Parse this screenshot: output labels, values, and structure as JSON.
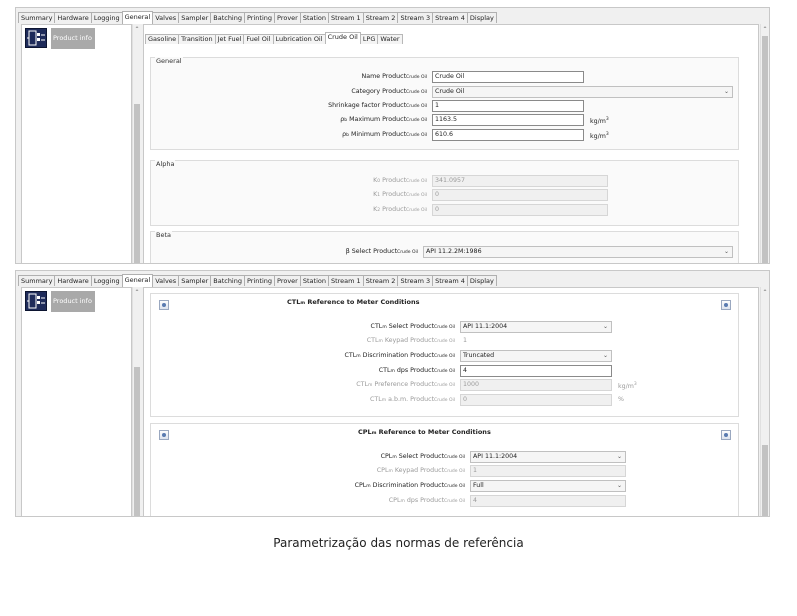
{
  "main_tabs": [
    "Summary",
    "Hardware",
    "Logging",
    "General",
    "Valves",
    "Sampler",
    "Batching",
    "Printing",
    "Prover",
    "Station",
    "Stream 1",
    "Stream 2",
    "Stream 3",
    "Stream 4",
    "Display"
  ],
  "active_main_tab": "General",
  "left_panel": {
    "icon": "flow-meter-icon",
    "item_label": "Product info"
  },
  "product_tabs": [
    "Gasoline",
    "Transition",
    "Jet Fuel",
    "Fuel Oil",
    "Lubrication Oil",
    "Crude Oil",
    "LPG",
    "Water"
  ],
  "active_product_tab": "Crude Oil",
  "product_subscript": "Crude Oil",
  "general": {
    "title": "General",
    "name_label": "Name Product",
    "name_value": "Crude Oil",
    "category_label": "Category Product",
    "category_value": "Crude Oil",
    "shrinkage_label": "Shrinkage factor Product",
    "shrinkage_value": "1",
    "rho_max_symbol": "ρ",
    "rho_sub": "b",
    "rho_max_label": " Maximum Product",
    "rho_max_value": "1163.5",
    "rho_min_label": " Minimum Product",
    "rho_min_value": "610.6",
    "density_unit": "kg/m",
    "density_unit_exp": "3"
  },
  "alpha": {
    "title": "Alpha",
    "k0_label": "K",
    "k0_sub": "0",
    "k0_value": "341.0957",
    "k1_label": "K",
    "k1_sub": "1",
    "k1_value": "0",
    "k2_label": "K",
    "k2_sub": "2",
    "k2_value": "0",
    "product_label": " Product"
  },
  "beta": {
    "title": "Beta",
    "select_label": "β Select Product",
    "select_value": "API 11.2.2M:1986"
  },
  "ctl": {
    "prefix": "CTL",
    "prefix_sub": "m",
    "title_rest": " Reference to Meter Conditions",
    "select_label": " Select Product",
    "select_value": "API 11.1:2004",
    "keypad_label": " Keypad Product",
    "keypad_value": "1",
    "discrimination_label": " Discrimination Product",
    "discrimination_value": "Truncated",
    "dps_label": " dps Product",
    "dps_value": "4",
    "preference_label": " Preference Product",
    "preference_value": "1000",
    "preference_unit": "kg/m",
    "preference_unit_exp": "3",
    "abm_label": " a.b.m. Product",
    "abm_value": "0",
    "abm_unit": "%"
  },
  "cpl": {
    "prefix": "CPL",
    "prefix_sub": "m",
    "title_rest": " Reference to Meter Conditions",
    "select_label": " Select Product",
    "select_value": "API 11.1:2004",
    "keypad_label": " Keypad Product",
    "keypad_value": "1",
    "discrimination_label": " Discrimination Product",
    "discrimination_value": "Full",
    "dps_label": " dps Product",
    "dps_value": "4"
  },
  "caption": "Parametrização das normas de referência"
}
